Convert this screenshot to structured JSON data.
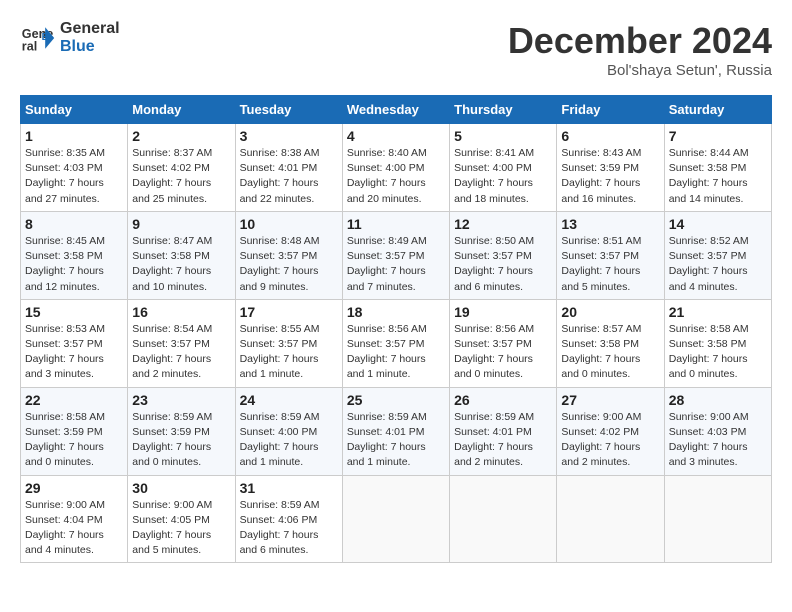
{
  "header": {
    "logo_line1": "General",
    "logo_line2": "Blue",
    "month": "December 2024",
    "location": "Bol'shaya Setun', Russia"
  },
  "weekdays": [
    "Sunday",
    "Monday",
    "Tuesday",
    "Wednesday",
    "Thursday",
    "Friday",
    "Saturday"
  ],
  "weeks": [
    [
      {
        "day": "1",
        "sunrise": "Sunrise: 8:35 AM",
        "sunset": "Sunset: 4:03 PM",
        "daylight": "Daylight: 7 hours and 27 minutes."
      },
      {
        "day": "2",
        "sunrise": "Sunrise: 8:37 AM",
        "sunset": "Sunset: 4:02 PM",
        "daylight": "Daylight: 7 hours and 25 minutes."
      },
      {
        "day": "3",
        "sunrise": "Sunrise: 8:38 AM",
        "sunset": "Sunset: 4:01 PM",
        "daylight": "Daylight: 7 hours and 22 minutes."
      },
      {
        "day": "4",
        "sunrise": "Sunrise: 8:40 AM",
        "sunset": "Sunset: 4:00 PM",
        "daylight": "Daylight: 7 hours and 20 minutes."
      },
      {
        "day": "5",
        "sunrise": "Sunrise: 8:41 AM",
        "sunset": "Sunset: 4:00 PM",
        "daylight": "Daylight: 7 hours and 18 minutes."
      },
      {
        "day": "6",
        "sunrise": "Sunrise: 8:43 AM",
        "sunset": "Sunset: 3:59 PM",
        "daylight": "Daylight: 7 hours and 16 minutes."
      },
      {
        "day": "7",
        "sunrise": "Sunrise: 8:44 AM",
        "sunset": "Sunset: 3:58 PM",
        "daylight": "Daylight: 7 hours and 14 minutes."
      }
    ],
    [
      {
        "day": "8",
        "sunrise": "Sunrise: 8:45 AM",
        "sunset": "Sunset: 3:58 PM",
        "daylight": "Daylight: 7 hours and 12 minutes."
      },
      {
        "day": "9",
        "sunrise": "Sunrise: 8:47 AM",
        "sunset": "Sunset: 3:58 PM",
        "daylight": "Daylight: 7 hours and 10 minutes."
      },
      {
        "day": "10",
        "sunrise": "Sunrise: 8:48 AM",
        "sunset": "Sunset: 3:57 PM",
        "daylight": "Daylight: 7 hours and 9 minutes."
      },
      {
        "day": "11",
        "sunrise": "Sunrise: 8:49 AM",
        "sunset": "Sunset: 3:57 PM",
        "daylight": "Daylight: 7 hours and 7 minutes."
      },
      {
        "day": "12",
        "sunrise": "Sunrise: 8:50 AM",
        "sunset": "Sunset: 3:57 PM",
        "daylight": "Daylight: 7 hours and 6 minutes."
      },
      {
        "day": "13",
        "sunrise": "Sunrise: 8:51 AM",
        "sunset": "Sunset: 3:57 PM",
        "daylight": "Daylight: 7 hours and 5 minutes."
      },
      {
        "day": "14",
        "sunrise": "Sunrise: 8:52 AM",
        "sunset": "Sunset: 3:57 PM",
        "daylight": "Daylight: 7 hours and 4 minutes."
      }
    ],
    [
      {
        "day": "15",
        "sunrise": "Sunrise: 8:53 AM",
        "sunset": "Sunset: 3:57 PM",
        "daylight": "Daylight: 7 hours and 3 minutes."
      },
      {
        "day": "16",
        "sunrise": "Sunrise: 8:54 AM",
        "sunset": "Sunset: 3:57 PM",
        "daylight": "Daylight: 7 hours and 2 minutes."
      },
      {
        "day": "17",
        "sunrise": "Sunrise: 8:55 AM",
        "sunset": "Sunset: 3:57 PM",
        "daylight": "Daylight: 7 hours and 1 minute."
      },
      {
        "day": "18",
        "sunrise": "Sunrise: 8:56 AM",
        "sunset": "Sunset: 3:57 PM",
        "daylight": "Daylight: 7 hours and 1 minute."
      },
      {
        "day": "19",
        "sunrise": "Sunrise: 8:56 AM",
        "sunset": "Sunset: 3:57 PM",
        "daylight": "Daylight: 7 hours and 0 minutes."
      },
      {
        "day": "20",
        "sunrise": "Sunrise: 8:57 AM",
        "sunset": "Sunset: 3:58 PM",
        "daylight": "Daylight: 7 hours and 0 minutes."
      },
      {
        "day": "21",
        "sunrise": "Sunrise: 8:58 AM",
        "sunset": "Sunset: 3:58 PM",
        "daylight": "Daylight: 7 hours and 0 minutes."
      }
    ],
    [
      {
        "day": "22",
        "sunrise": "Sunrise: 8:58 AM",
        "sunset": "Sunset: 3:59 PM",
        "daylight": "Daylight: 7 hours and 0 minutes."
      },
      {
        "day": "23",
        "sunrise": "Sunrise: 8:59 AM",
        "sunset": "Sunset: 3:59 PM",
        "daylight": "Daylight: 7 hours and 0 minutes."
      },
      {
        "day": "24",
        "sunrise": "Sunrise: 8:59 AM",
        "sunset": "Sunset: 4:00 PM",
        "daylight": "Daylight: 7 hours and 1 minute."
      },
      {
        "day": "25",
        "sunrise": "Sunrise: 8:59 AM",
        "sunset": "Sunset: 4:01 PM",
        "daylight": "Daylight: 7 hours and 1 minute."
      },
      {
        "day": "26",
        "sunrise": "Sunrise: 8:59 AM",
        "sunset": "Sunset: 4:01 PM",
        "daylight": "Daylight: 7 hours and 2 minutes."
      },
      {
        "day": "27",
        "sunrise": "Sunrise: 9:00 AM",
        "sunset": "Sunset: 4:02 PM",
        "daylight": "Daylight: 7 hours and 2 minutes."
      },
      {
        "day": "28",
        "sunrise": "Sunrise: 9:00 AM",
        "sunset": "Sunset: 4:03 PM",
        "daylight": "Daylight: 7 hours and 3 minutes."
      }
    ],
    [
      {
        "day": "29",
        "sunrise": "Sunrise: 9:00 AM",
        "sunset": "Sunset: 4:04 PM",
        "daylight": "Daylight: 7 hours and 4 minutes."
      },
      {
        "day": "30",
        "sunrise": "Sunrise: 9:00 AM",
        "sunset": "Sunset: 4:05 PM",
        "daylight": "Daylight: 7 hours and 5 minutes."
      },
      {
        "day": "31",
        "sunrise": "Sunrise: 8:59 AM",
        "sunset": "Sunset: 4:06 PM",
        "daylight": "Daylight: 7 hours and 6 minutes."
      },
      null,
      null,
      null,
      null
    ]
  ]
}
